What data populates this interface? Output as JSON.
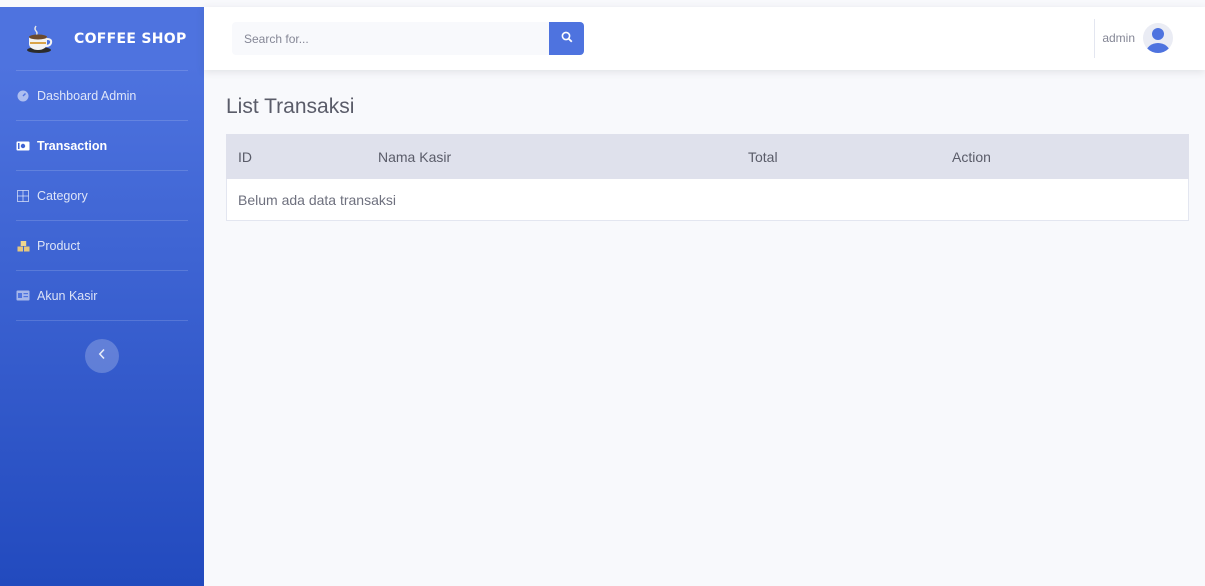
{
  "brand": {
    "name": "COFFEE SHOP",
    "icon": "coffee-cup-icon"
  },
  "sidebar": {
    "items": [
      {
        "label": "Dashboard Admin",
        "icon": "dashboard-icon",
        "active": false
      },
      {
        "label": "Transaction",
        "icon": "money-bill-icon",
        "active": true
      },
      {
        "label": "Category",
        "icon": "grid-icon",
        "active": false
      },
      {
        "label": "Product",
        "icon": "boxes-icon",
        "active": false
      },
      {
        "label": "Akun Kasir",
        "icon": "id-card-icon",
        "active": false
      }
    ],
    "toggle_icon": "chevron-left-icon"
  },
  "topbar": {
    "search": {
      "placeholder": "Search for...",
      "value": "",
      "button_icon": "search-icon"
    },
    "user": {
      "name": "admin",
      "avatar_icon": "user-avatar-icon"
    }
  },
  "main": {
    "title": "List Transaksi",
    "table": {
      "columns": [
        "ID",
        "Nama Kasir",
        "Total",
        "Action"
      ],
      "empty_message": "Belum ada data transaksi"
    }
  },
  "colors": {
    "primary": "#4e73df",
    "sidebar_gradient_end": "#224abe",
    "table_header_bg": "#dfe1ec",
    "page_bg": "#f8f9fc"
  }
}
